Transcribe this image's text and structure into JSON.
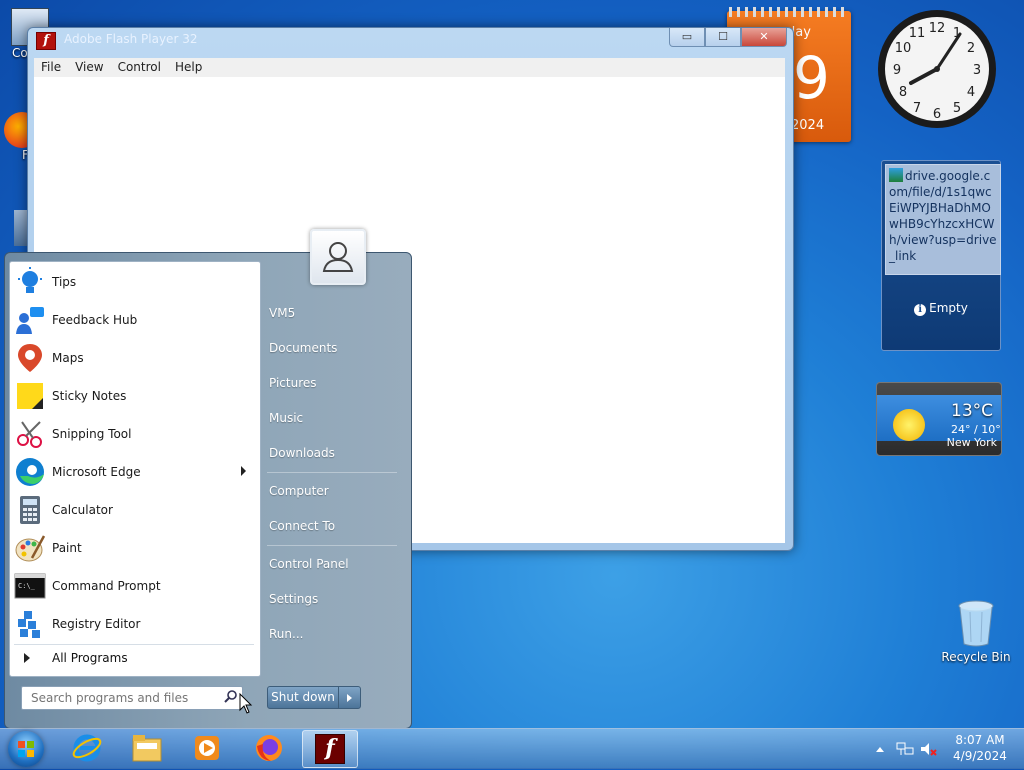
{
  "desktop": {
    "icon_labels": [
      "Co",
      "F"
    ]
  },
  "window": {
    "title": "Adobe Flash Player 32",
    "app_icon_glyph": "f",
    "buttons": {
      "minimize": "▭",
      "maximize": "☐",
      "close": "✕"
    },
    "menu": [
      "File",
      "View",
      "Control",
      "Help"
    ]
  },
  "calendar": {
    "day": "day",
    "date_glyph": "9",
    "year": "2024"
  },
  "feed": {
    "link_text": "drive.google.com/file/d/1s1qwcEiWPYJBHaDhMOwHB9cYhzcxHCWh/view?usp=drive_link",
    "status": "Empty",
    "info_glyph": "i"
  },
  "weather": {
    "temp": "13°C",
    "range": "24° / 10°",
    "city": "New York"
  },
  "recycle_bin": {
    "label": "Recycle Bin"
  },
  "start_menu": {
    "programs": [
      {
        "label": "Tips",
        "icon": "tips-icon"
      },
      {
        "label": "Feedback Hub",
        "icon": "feedback-hub-icon"
      },
      {
        "label": "Maps",
        "icon": "maps-icon"
      },
      {
        "label": "Sticky Notes",
        "icon": "sticky-notes-icon"
      },
      {
        "label": "Snipping Tool",
        "icon": "snipping-tool-icon"
      },
      {
        "label": "Microsoft Edge",
        "icon": "edge-icon"
      },
      {
        "label": "Calculator",
        "icon": "calculator-icon"
      },
      {
        "label": "Paint",
        "icon": "paint-icon"
      },
      {
        "label": "Command Prompt",
        "icon": "command-prompt-icon"
      },
      {
        "label": "Registry Editor",
        "icon": "registry-editor-icon"
      }
    ],
    "all_programs": "All Programs",
    "search_placeholder": "Search programs and files",
    "right_items": [
      "VM5",
      "Documents",
      "Pictures",
      "Music",
      "Downloads",
      "Computer",
      "Connect To",
      "Control Panel",
      "Settings",
      "Run..."
    ],
    "shutdown": "Shut down"
  },
  "taskbar": {
    "pinned": [
      "start-orb",
      "internet-explorer-icon",
      "file-explorer-icon",
      "media-player-icon",
      "firefox-icon",
      "flash-player-icon"
    ],
    "time": "8:07 AM",
    "date": "4/9/2024"
  },
  "colors": {
    "accent": "#1f7fd6",
    "flash_red": "#b2110c",
    "calendar_orange": "#e8681a"
  }
}
